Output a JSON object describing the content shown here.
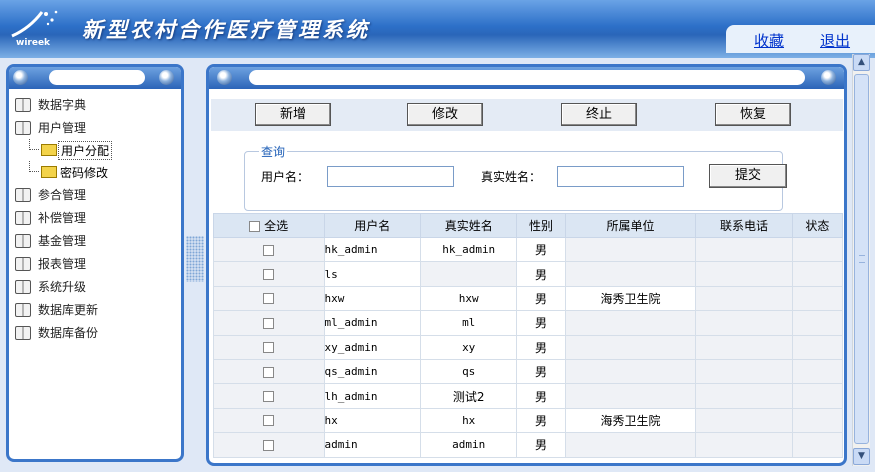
{
  "header": {
    "logo_text": "wireek",
    "title": "新型农村合作医疗管理系统",
    "links": [
      "收藏",
      "退出"
    ]
  },
  "sidebar": {
    "items": [
      {
        "label": "数据字典"
      },
      {
        "label": "用户管理"
      },
      {
        "label": "用户分配",
        "sub": true,
        "selected": true
      },
      {
        "label": "密码修改",
        "sub": true
      },
      {
        "label": "参合管理"
      },
      {
        "label": "补偿管理"
      },
      {
        "label": "基金管理"
      },
      {
        "label": "报表管理"
      },
      {
        "label": "系统升级"
      },
      {
        "label": "数据库更新"
      },
      {
        "label": "数据库备份"
      }
    ]
  },
  "toolbar": {
    "add_label": "新增",
    "edit_label": "修改",
    "stop_label": "终止",
    "restore_label": "恢复"
  },
  "query": {
    "legend": "查询",
    "username_label": "用户名：",
    "username_value": "",
    "realname_label": "真实姓名：",
    "realname_value": "",
    "submit_label": "提交"
  },
  "table": {
    "select_all_label": "全选",
    "columns": [
      "用户名",
      "真实姓名",
      "性别",
      "所属单位",
      "联系电话",
      "状态"
    ],
    "rows": [
      {
        "username": "hk_admin",
        "realname": "hk_admin",
        "gender": "男",
        "unit": "",
        "phone": "",
        "status": ""
      },
      {
        "username": "ls",
        "realname": "",
        "gender": "男",
        "unit": "",
        "phone": "",
        "status": ""
      },
      {
        "username": "hxw",
        "realname": "hxw",
        "gender": "男",
        "unit": "海秀卫生院",
        "phone": "",
        "status": ""
      },
      {
        "username": "ml_admin",
        "realname": "ml",
        "gender": "男",
        "unit": "",
        "phone": "",
        "status": ""
      },
      {
        "username": "xy_admin",
        "realname": "xy",
        "gender": "男",
        "unit": "",
        "phone": "",
        "status": ""
      },
      {
        "username": "qs_admin",
        "realname": "qs",
        "gender": "男",
        "unit": "",
        "phone": "",
        "status": ""
      },
      {
        "username": "lh_admin",
        "realname": "测试2",
        "gender": "男",
        "unit": "",
        "phone": "",
        "status": ""
      },
      {
        "username": "hx",
        "realname": "hx",
        "gender": "男",
        "unit": "海秀卫生院",
        "phone": "",
        "status": ""
      },
      {
        "username": "admin",
        "realname": "admin",
        "gender": "男",
        "unit": "",
        "phone": "",
        "status": ""
      }
    ]
  },
  "colors": {
    "header_blue": "#2d70c8",
    "panel_border": "#3b76c9",
    "link": "#0033cc",
    "legend": "#1f5fb7"
  }
}
